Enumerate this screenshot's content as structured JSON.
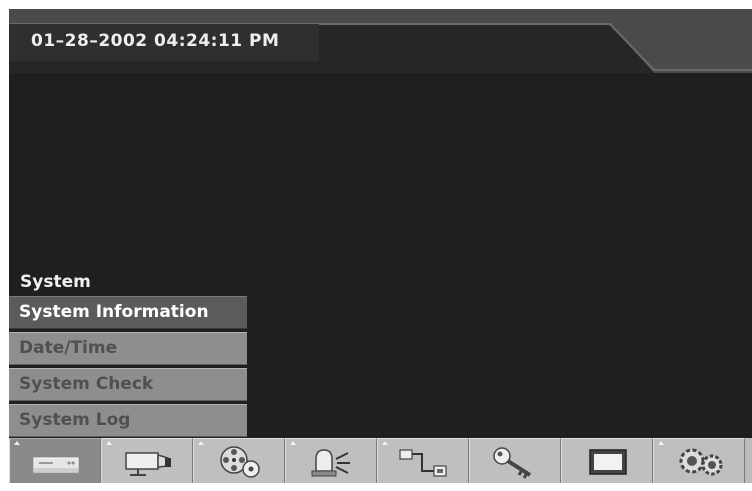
{
  "header": {
    "datetime": "01–28–2002 04:24:11 PM"
  },
  "menu": {
    "title": "System",
    "items": [
      {
        "label": "System Information",
        "selected": true
      },
      {
        "label": "Date/Time",
        "selected": false
      },
      {
        "label": "System Check",
        "selected": false
      },
      {
        "label": "System Log",
        "selected": false
      }
    ]
  },
  "toolbar": {
    "buttons": [
      {
        "icon": "dvr-recorder-icon",
        "selected": true
      },
      {
        "icon": "camera-icon",
        "selected": false
      },
      {
        "icon": "film-reel-icon",
        "selected": false
      },
      {
        "icon": "alarm-light-icon",
        "selected": false
      },
      {
        "icon": "network-connection-icon",
        "selected": false
      },
      {
        "icon": "key-icon",
        "selected": false
      },
      {
        "icon": "monitor-icon",
        "selected": false
      },
      {
        "icon": "gears-icon",
        "selected": false
      }
    ]
  },
  "colors": {
    "screen_background": "#1f1f1f",
    "header_bar": "#2a2a2a",
    "menu_selected": "#5b5b5b",
    "menu_item": "#8e8e8e",
    "toolbar": "#bfbfbf"
  }
}
